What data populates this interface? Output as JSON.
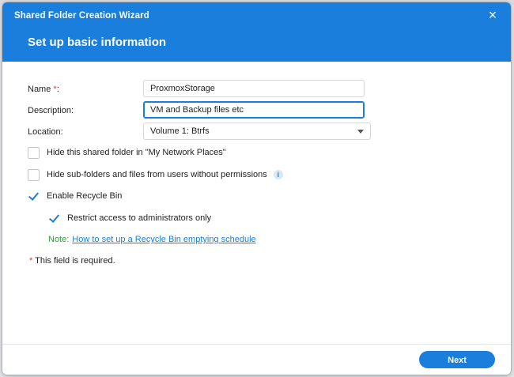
{
  "window": {
    "title": "Shared Folder Creation Wizard",
    "close_glyph": "×",
    "step_title": "Set up basic information"
  },
  "form": {
    "name": {
      "label": "Name ",
      "required_mark": "*",
      "colon": ":",
      "value": "ProxmoxStorage"
    },
    "description": {
      "label": "Description:",
      "value": "VM and Backup files etc"
    },
    "location": {
      "label": "Location:",
      "value": "Volume 1:  Btrfs"
    }
  },
  "options": {
    "hide_network_places": {
      "label": "Hide this shared folder in \"My Network Places\"",
      "checked": false
    },
    "hide_subfolders": {
      "label": "Hide sub-folders and files from users without permissions",
      "checked": false,
      "info_glyph": "i"
    },
    "recycle_bin": {
      "label": "Enable Recycle Bin",
      "checked": true
    },
    "restrict_admin": {
      "label": "Restrict access to administrators only",
      "checked": true
    }
  },
  "note": {
    "label": "Note:",
    "link": "How to set up a Recycle Bin emptying schedule"
  },
  "required_notice": {
    "mark": "*",
    "text": " This field is required."
  },
  "footer": {
    "next_label": "Next"
  },
  "colors": {
    "accent": "#1a7fdc",
    "required": "#e53935",
    "note": "#2e9d38"
  }
}
